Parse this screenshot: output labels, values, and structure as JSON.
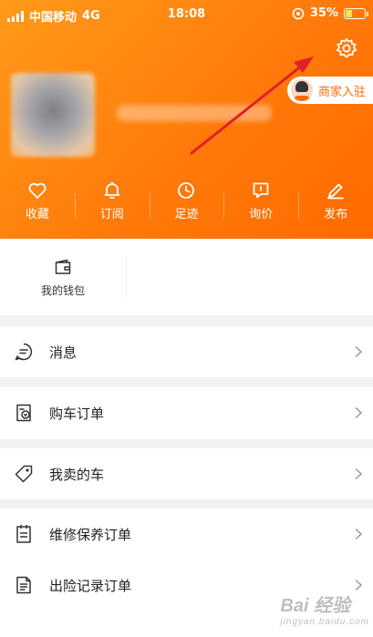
{
  "status_bar": {
    "carrier": "中国移动",
    "network": "4G",
    "time": "18:08",
    "battery": "35%",
    "battery_level": 0.35
  },
  "header": {
    "merchant_label": "商家入驻"
  },
  "quick_actions": [
    {
      "label": "收藏",
      "icon": "heart-icon"
    },
    {
      "label": "订阅",
      "icon": "bell-icon"
    },
    {
      "label": "足迹",
      "icon": "clock-icon"
    },
    {
      "label": "询价",
      "icon": "message-square-icon"
    },
    {
      "label": "发布",
      "icon": "pen-icon"
    }
  ],
  "wallet": {
    "label": "我的钱包",
    "icon": "wallet-icon"
  },
  "menu": [
    {
      "label": "消息",
      "icon": "chat-bubble-icon"
    },
    {
      "label": "购车订单",
      "icon": "car-order-icon"
    },
    {
      "label": "我卖的车",
      "icon": "tag-icon"
    },
    {
      "label": "维修保养订单",
      "icon": "clipboard-icon"
    },
    {
      "label": "出险记录订单",
      "icon": "document-icon"
    }
  ],
  "watermark": {
    "brand": "Bai 经验",
    "url": "jingyan.baidu.com"
  },
  "colors": {
    "accent": "#ff7a0a",
    "background": "#f2f2f2",
    "annotation_arrow": "#e0202a"
  }
}
